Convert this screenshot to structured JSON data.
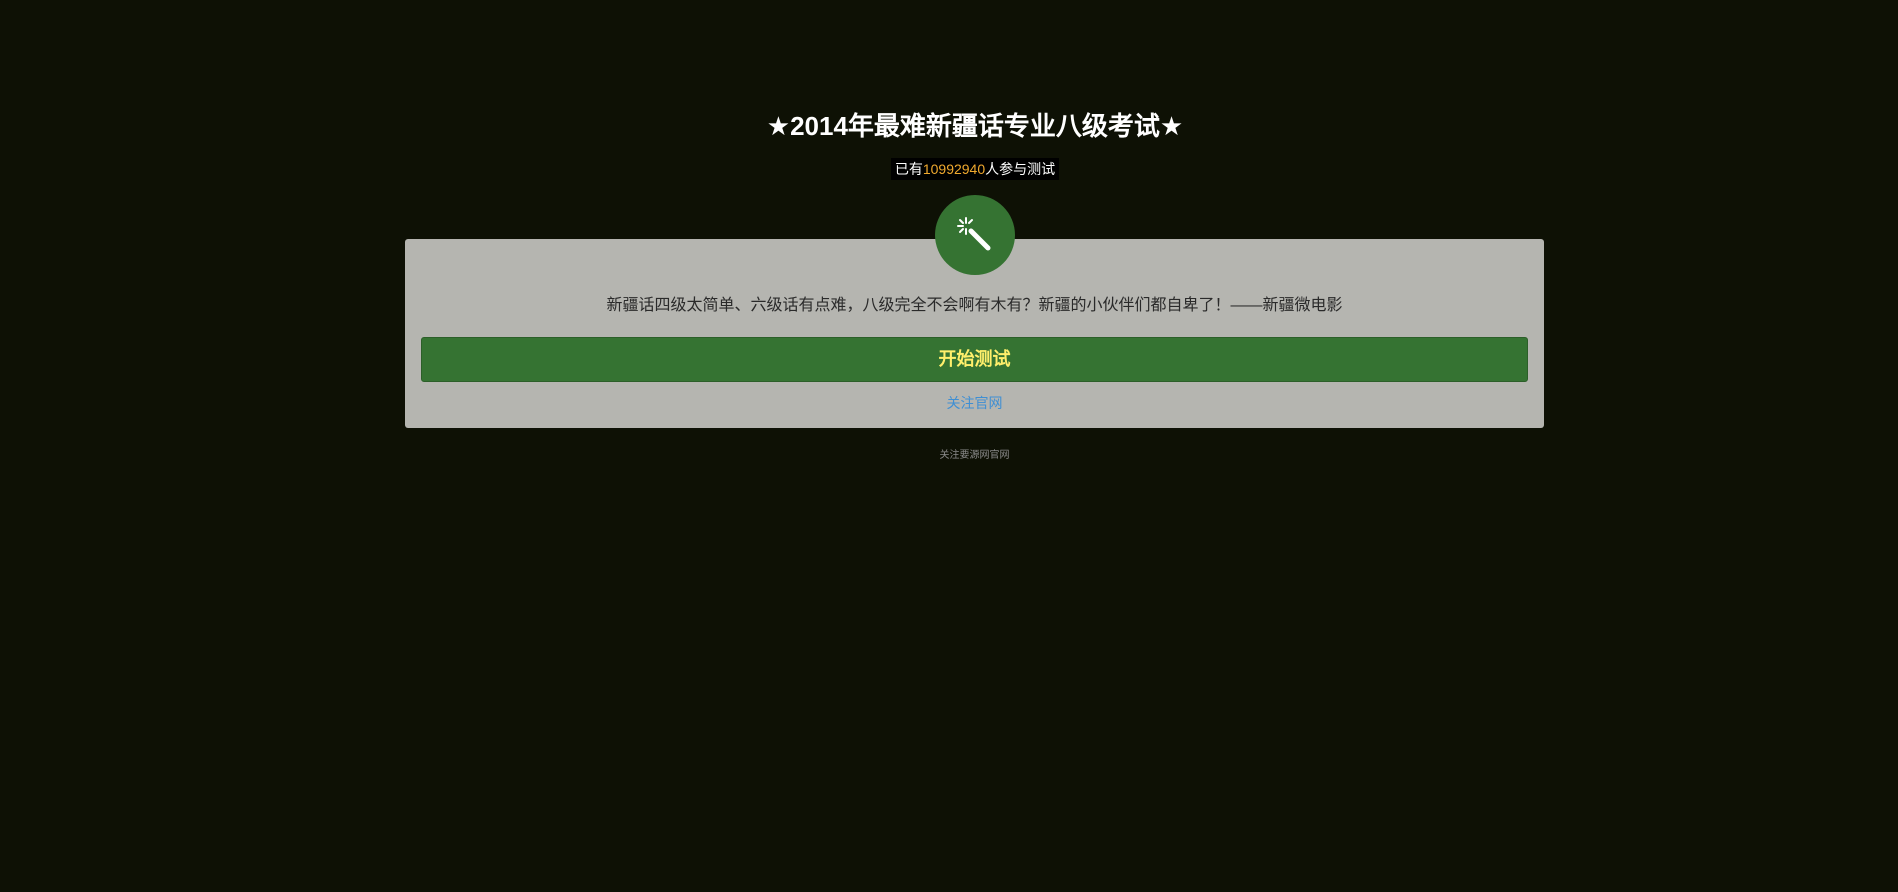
{
  "header": {
    "title": "★2014年最难新疆话专业八级考试★",
    "counter_prefix": "已有",
    "counter_value": "10992940",
    "counter_suffix": "人参与测试"
  },
  "badge": {
    "icon": "magic-wand-icon"
  },
  "card": {
    "description": "新疆话四级太简单、六级话有点难，八级完全不会啊有木有？新疆的小伙伴们都自卑了！——新疆微电影",
    "start_button_label": "开始测试",
    "follow_link_label": "关注官网"
  },
  "footer": {
    "link_label": "关注要源网官网"
  },
  "colors": {
    "background": "#0e1105",
    "accent_green": "#357332",
    "button_text": "#ffef6b",
    "counter_number": "#f0a92e",
    "link_blue": "#3f8fd3",
    "card_background": "#b5b5b0"
  }
}
